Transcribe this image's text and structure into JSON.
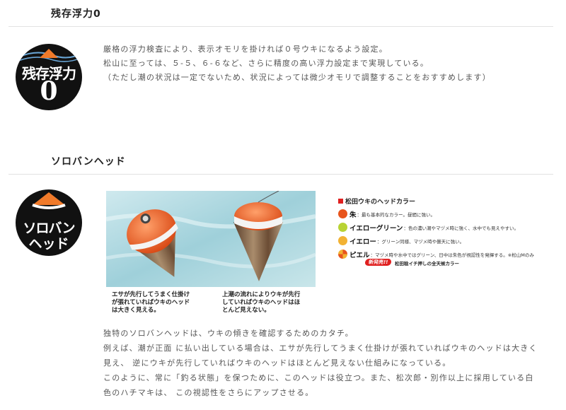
{
  "section1": {
    "title": "残存浮力0",
    "badge": {
      "line1": "残存浮力",
      "numeral": "0"
    },
    "lines": [
      "厳格の浮力検査により、表示オモリを掛ければ０号ウキになるよう設定。",
      "松山に至っては、５-５、６-６など、さらに精度の高い浮力設定まで実現している。",
      "（ただし潮の状況は一定でないため、状況によっては微少オモリで調整することをおすすめします）"
    ]
  },
  "section2": {
    "title": "ソロバンヘッド",
    "badge": {
      "line1": "ソロバン",
      "line2": "ヘッド"
    },
    "captions": [
      "エサが先行してうまく仕掛け\nが張れていればウキのヘッド\nは大きく見える。",
      "上潮の流れによりウキが先行\nしていればウキのヘッドはほ\nとんど見えない。"
    ],
    "legend": {
      "title": "松田ウキのヘッドカラー",
      "items": [
        {
          "name": "朱",
          "desc": "：最も基本的なカラー。昼間に強い。",
          "color": "#e8541c"
        },
        {
          "name": "イエローグリーン",
          "desc": "：色の濃い潮やマヅメ時に強く、水中でも見えやすい。",
          "color": "#b8d334"
        },
        {
          "name": "イエロー",
          "desc": "：グリーン同様、マヅメ時や曇天に強い。",
          "color": "#f2b233"
        },
        {
          "name": "ピエル",
          "desc": "：マヅメ時や水中ではグリーン、日中は朱色が視認性を発揮する。※松山Mのみ",
          "color": "#e8541c"
        }
      ],
      "new_tag": "新発売!!",
      "new_sub": "松田稔イチ押しの全天候カラー"
    },
    "lines": [
      "独特のソロバンヘッドは、ウキの傾きを確認するためのカタチ。",
      "例えば、潮が正面 に払い出している場合は、エサが先行してうまく仕掛けが張れていればウキのヘッドは大きく",
      "見え、 逆にウキが先行していればウキのヘッドはほとんど見えない仕組みになっている。",
      "このように、常に「釣る状態」を保つために、このヘッドは役立つ。また、松次郎・別作以上に採用している白",
      "色のハチマキは、 この視認性をさらにアップさせる。"
    ]
  }
}
